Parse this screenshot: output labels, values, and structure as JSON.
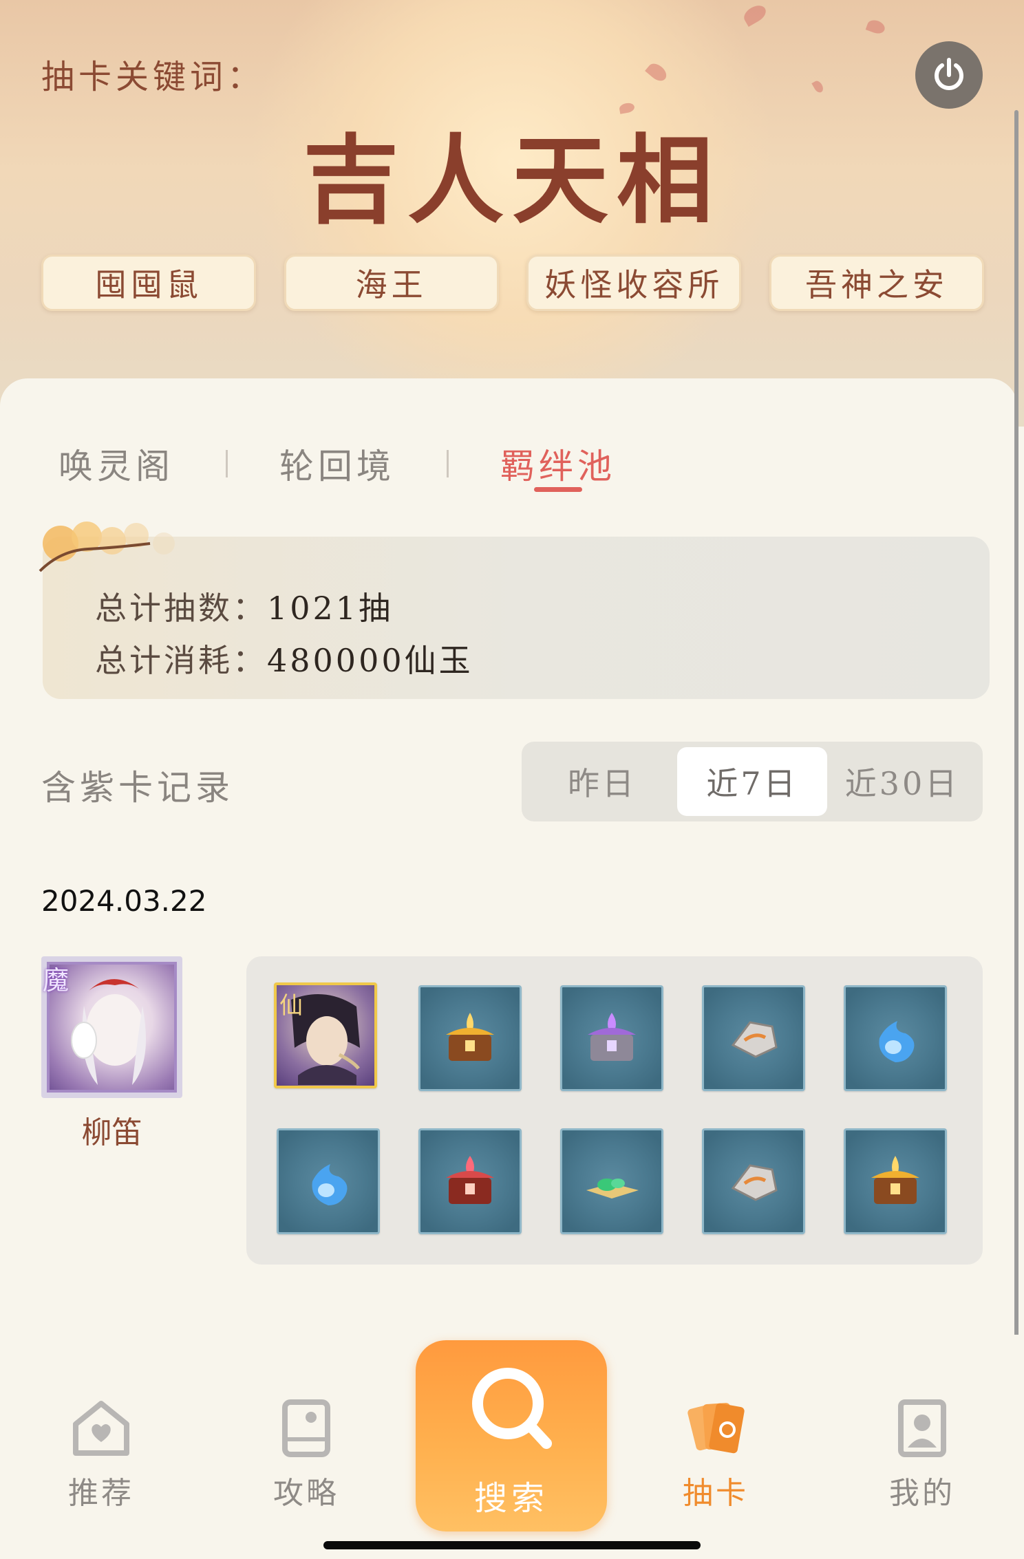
{
  "header": {
    "keyword_label": "抽卡关键词：",
    "keyword_title": "吉人天相",
    "tags": [
      "囤囤鼠",
      "海王",
      "妖怪收容所",
      "吾神之安"
    ]
  },
  "pool_tabs": [
    {
      "label": "唤灵阁",
      "active": false
    },
    {
      "label": "轮回境",
      "active": false
    },
    {
      "label": "羁绊池",
      "active": true
    }
  ],
  "stats": {
    "total_draws_label": "总计抽数：",
    "total_draws_value": "1021抽",
    "total_cost_label": "总计消耗：",
    "total_cost_value": "480000仙玉"
  },
  "records": {
    "title": "含紫卡记录",
    "ranges": [
      "昨日",
      "近7日",
      "近30日"
    ],
    "selected_range": "近7日",
    "date": "2024.03.22",
    "character": {
      "badge": "魔",
      "name": "柳笛"
    },
    "hero_badge": "仙",
    "items": [
      "hero-card",
      "gold-chest-icon",
      "purple-chest-icon",
      "stone-icon",
      "blue-flame-icon",
      "blue-flame-icon",
      "red-chest-icon",
      "jade-icon",
      "stone-icon",
      "gold-chest-icon"
    ]
  },
  "nav": {
    "items": [
      "推荐",
      "攻略",
      "搜索",
      "抽卡",
      "我的"
    ],
    "active": "抽卡"
  },
  "colors": {
    "accent": "#e0615b",
    "brand_title": "#8a3f2c",
    "nav_active": "#f08b2c",
    "search_button": "#ff9a3e"
  }
}
